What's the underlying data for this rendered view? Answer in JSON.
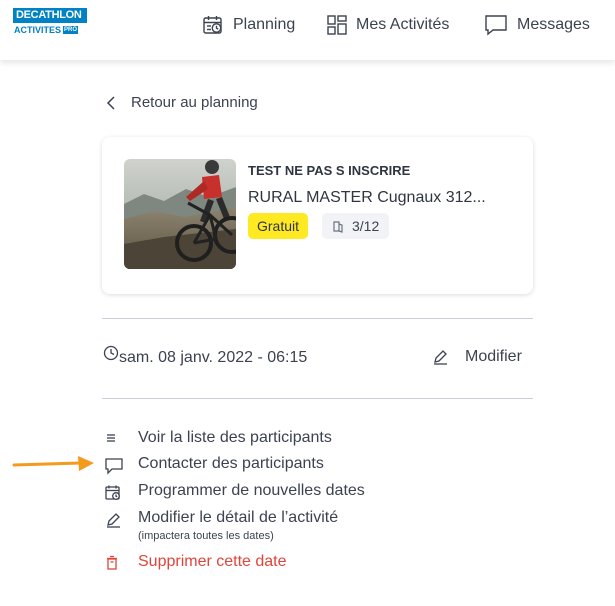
{
  "header": {
    "logo_line1": "DECATHLON",
    "logo_line2": "ACTIVITES",
    "logo_badge": "PRO",
    "nav": [
      {
        "label": "Planning",
        "icon": "calendar-icon"
      },
      {
        "label": "Mes Activités",
        "icon": "grid-icon"
      },
      {
        "label": "Messages",
        "icon": "chat-icon"
      }
    ]
  },
  "back_link": {
    "label": "Retour au planning",
    "icon": "chevron-left-icon"
  },
  "activity_card": {
    "title": "TEST NE PAS S INSCRIRE",
    "subtitle": "RURAL MASTER Cugnaux 312...",
    "price_badge": "Gratuit",
    "participants": "3/12",
    "image": "mountain-biker-photo"
  },
  "session": {
    "date_time": "sam. 08 janv. 2022 - 06:15",
    "modify_label": "Modifier"
  },
  "actions": [
    {
      "label": "Voir la liste des participants",
      "icon": "list-icon"
    },
    {
      "label": "Contacter des participants",
      "icon": "chat-icon"
    },
    {
      "label": "Programmer de nouvelles dates",
      "icon": "calendar-icon"
    },
    {
      "label": "Modifier le détail de l’activité",
      "sub": "(impactera toutes les dates)",
      "icon": "pencil-icon"
    },
    {
      "label": "Supprimer cette date",
      "icon": "trash-icon",
      "color": "#e0453a"
    }
  ],
  "colors": {
    "brand": "#0082c3",
    "badge_yellow": "#ffe922",
    "danger": "#e0453a",
    "annotation_arrow": "#f29b1d"
  }
}
